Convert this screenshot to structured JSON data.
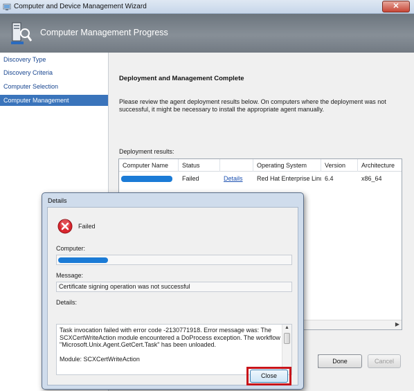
{
  "window": {
    "title": "Computer and Device Management Wizard",
    "close_glyph": "✕"
  },
  "header": {
    "title": "Computer Management Progress"
  },
  "nav": {
    "items": [
      {
        "label": "Discovery Type",
        "active": false
      },
      {
        "label": "Discovery Criteria",
        "active": false
      },
      {
        "label": "Computer Selection",
        "active": false
      },
      {
        "label": "Computer Management",
        "active": true
      }
    ]
  },
  "content": {
    "heading": "Deployment and Management Complete",
    "description": "Please review the agent deployment results below. On computers where the deployment was not successful, it might be necessary to install the appropriate agent manually.",
    "results_label": "Deployment results:",
    "table": {
      "columns": [
        "Computer Name",
        "Status",
        "",
        "Operating System",
        "Version",
        "Architecture"
      ],
      "rows": [
        {
          "computer": "",
          "status": "Failed",
          "details": "Details",
          "os": "Red Hat Enterprise Linux",
          "version": "6.4",
          "arch": "x86_64"
        }
      ]
    },
    "buttons": {
      "done": "Done",
      "cancel": "Cancel"
    }
  },
  "dialog": {
    "title": "Details",
    "status": "Failed",
    "computer_label": "Computer:",
    "message_label": "Message:",
    "message": "Certificate signing operation was not successful",
    "details_label": "Details:",
    "details_text": "Task invocation failed with error code -2130771918. Error message was: The SCXCertWriteAction module encountered a DoProcess exception. The workflow \"Microsoft.Unix.Agent.GetCert.Task\" has been unloaded.\n\nModule: SCXCertWriteAction",
    "close": "Close"
  },
  "colors": {
    "accent": "#3a74bb",
    "highlight": "#c8141a",
    "redaction": "#1b7bd6",
    "error": "#d9262e"
  }
}
